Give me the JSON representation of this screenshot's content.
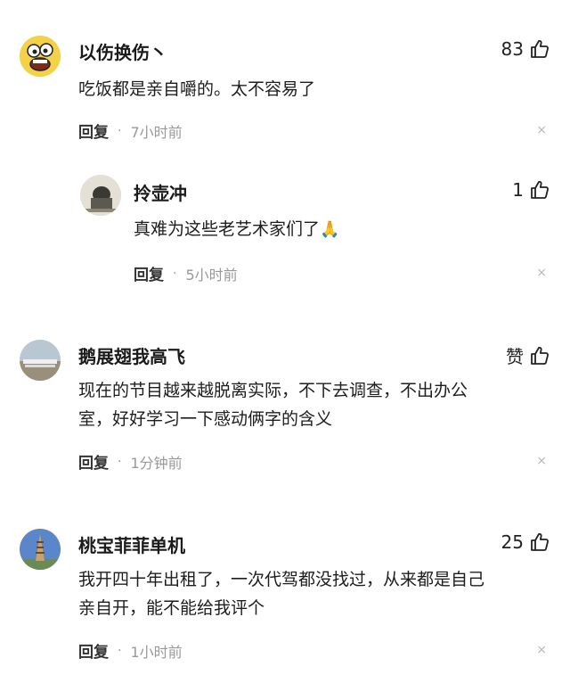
{
  "comments": [
    {
      "username": "以伤换伤丶",
      "likes": "83",
      "text": "吃饭都是亲自嚼的。太不容易了",
      "reply_label": "回复",
      "time": "7小时前",
      "close": "×",
      "avatar_icon": "cartoon-face-avatar",
      "replies": [
        {
          "username": "拎壶冲",
          "likes": "1",
          "text": "真难为这些老艺术家们了",
          "emoji": "🙏",
          "reply_label": "回复",
          "time": "5小时前",
          "close": "×",
          "avatar_icon": "photo-avatar"
        }
      ]
    },
    {
      "username": "鹅展翅我高飞",
      "likes": "赞",
      "text_lines": [
        "现在的节目越来越脱离实际，不下去调查，不出办公",
        "室，好好学习一下感动俩字的含义"
      ],
      "reply_label": "回复",
      "time": "1分钟前",
      "close": "×",
      "avatar_icon": "landscape-avatar"
    },
    {
      "username": "桃宝菲菲单机",
      "likes": "25",
      "text_lines": [
        "我开四十年出租了，一次代驾都没找过，从来都是自己",
        "亲自开，能不能给我评个"
      ],
      "reply_label": "回复",
      "time": "1小时前",
      "close": "×",
      "avatar_icon": "tower-avatar"
    }
  ]
}
